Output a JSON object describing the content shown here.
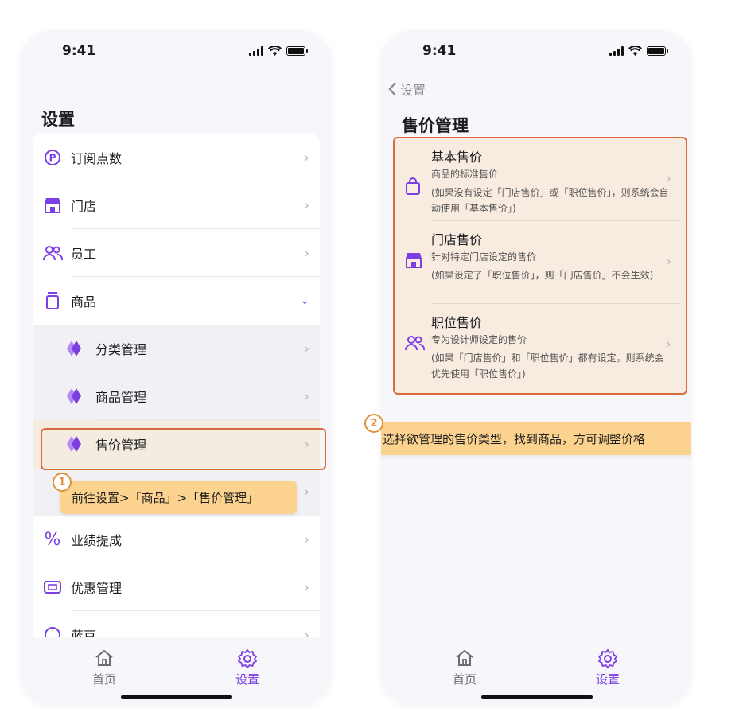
{
  "phone1": {
    "status_time": "9:41",
    "title": "设置",
    "rows": [
      {
        "label": "订阅点数",
        "icon": "points-icon"
      },
      {
        "label": "门店",
        "icon": "store-icon"
      },
      {
        "label": "员工",
        "icon": "staff-icon"
      },
      {
        "label": "商品",
        "icon": "product-icon",
        "expanded": true
      },
      {
        "label": "分类管理",
        "icon": "category-icon",
        "sub": true
      },
      {
        "label": "商品管理",
        "icon": "product-manage-icon",
        "sub": true
      },
      {
        "label": "售价管理",
        "icon": "price-manage-icon",
        "sub": true,
        "highlighted": true
      },
      {
        "label": "",
        "icon": "",
        "sub": true
      },
      {
        "label": "业绩提成",
        "icon": "percent-icon"
      },
      {
        "label": "优惠管理",
        "icon": "coupon-icon"
      },
      {
        "label": "蓝豆",
        "icon": "clock-icon"
      }
    ],
    "callout": {
      "number": "1",
      "text": "前往设置>「商品」>「售价管理」"
    },
    "tabs": [
      {
        "label": "首页"
      },
      {
        "label": "设置"
      }
    ]
  },
  "phone2": {
    "status_time": "9:41",
    "back_label": "设置",
    "title": "售价管理",
    "items": [
      {
        "title": "基本售价",
        "subtitle": "商品的标准售价",
        "note": "(如果没有设定「门店售价」或「职位售价」，则系统会自动使用「基本售价」)",
        "icon": "bag-icon"
      },
      {
        "title": "门店售价",
        "subtitle": "针对特定门店设定的售价",
        "note": "(如果设定了「职位售价」，则「门店售价」不会生效)",
        "icon": "store-icon"
      },
      {
        "title": "职位售价",
        "subtitle": "专为设计师设定的售价",
        "note": "(如果「门店售价」和「职位售价」都有设定，则系统会优先使用「职位售价」)",
        "icon": "staff-icon"
      }
    ],
    "callout": {
      "number": "2",
      "text": "选择欲管理的售价类型，找到商品，方可调整价格"
    },
    "tabs": [
      {
        "label": "首页"
      },
      {
        "label": "设置"
      }
    ]
  },
  "colors": {
    "accent": "#7b3fe4",
    "callout": "#fbd28e",
    "highlight_border": "#d96b3c"
  }
}
